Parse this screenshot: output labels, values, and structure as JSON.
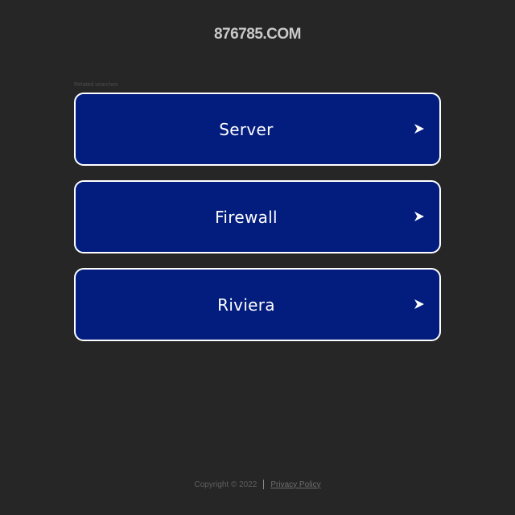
{
  "header": {
    "domain": "876785.COM"
  },
  "related": {
    "label": "Related searches",
    "items": [
      {
        "label": "Server",
        "icon": "arrow-right-icon"
      },
      {
        "label": "Firewall",
        "icon": "arrow-right-icon"
      },
      {
        "label": "Riviera",
        "icon": "arrow-right-icon"
      }
    ]
  },
  "footer": {
    "copyright": "Copyright © 2022",
    "privacy": "Privacy Policy"
  },
  "colors": {
    "background": "#262626",
    "button_fill": "#031d7e",
    "button_border": "#ffffff",
    "title": "#c9c9c9"
  }
}
